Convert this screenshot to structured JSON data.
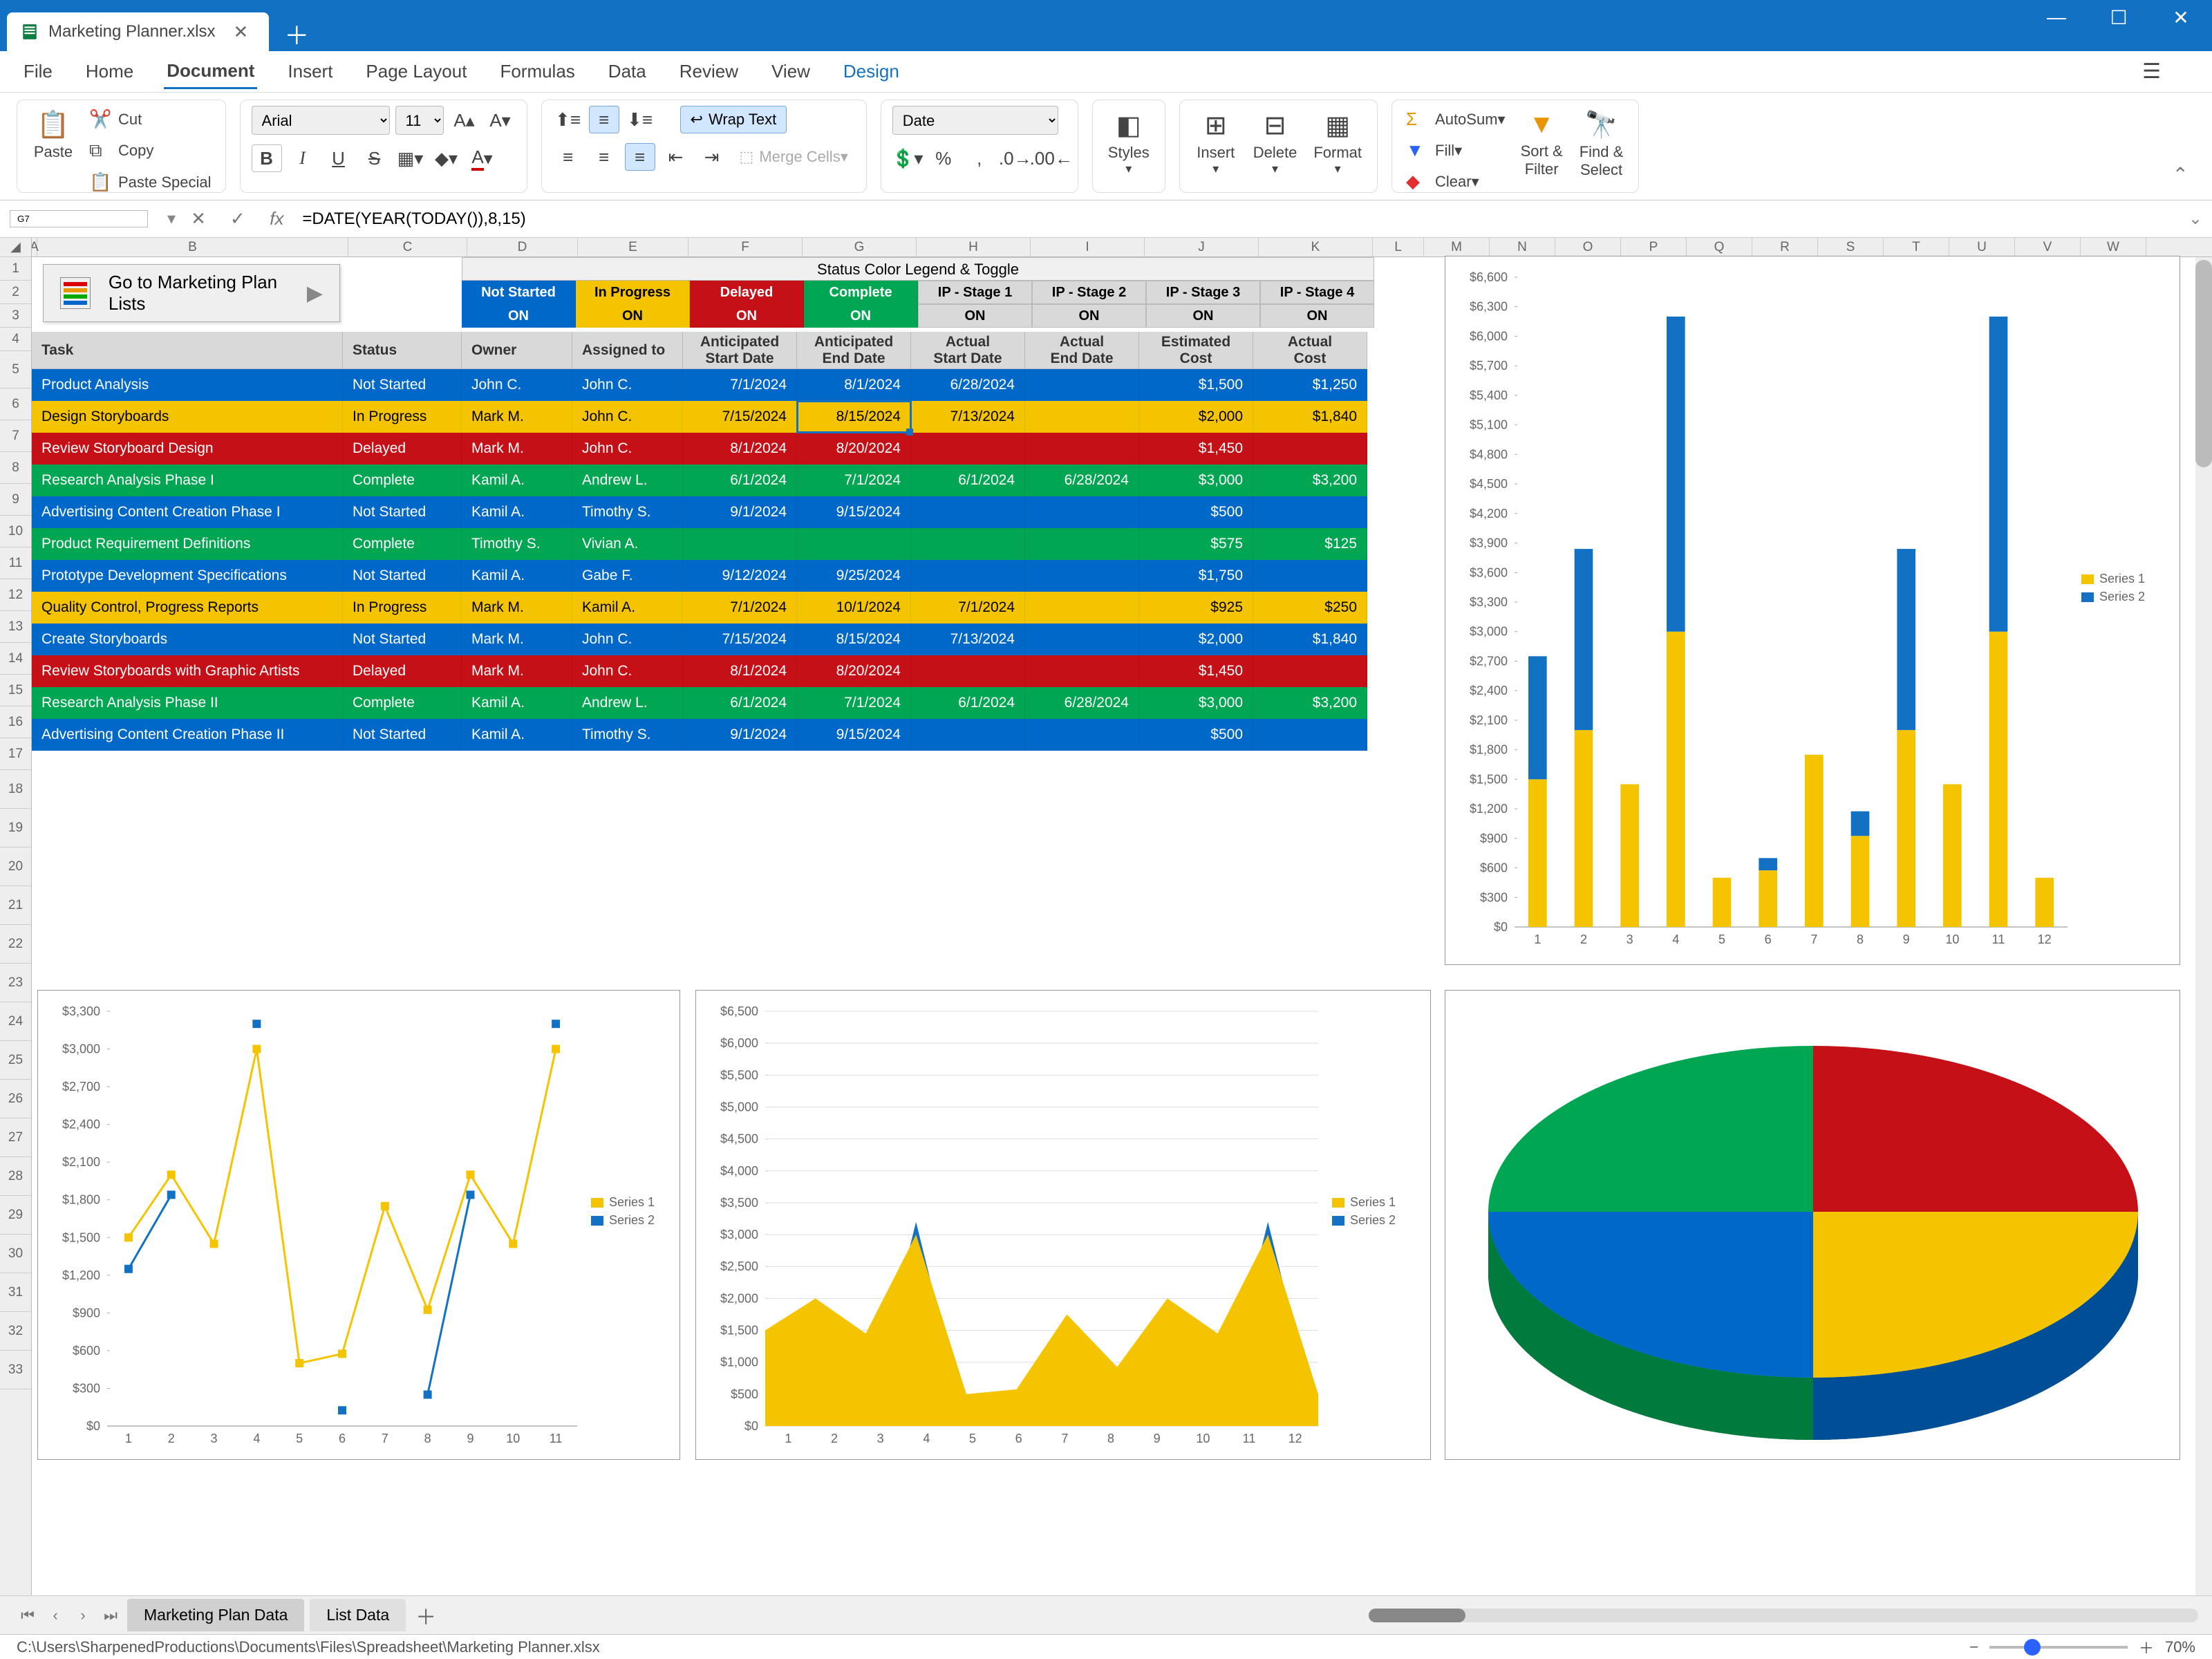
{
  "title": "Marketing Planner.xlsx",
  "menus": [
    "File",
    "Home",
    "Document",
    "Insert",
    "Page Layout",
    "Formulas",
    "Data",
    "Review",
    "View",
    "Design"
  ],
  "active_menu": "Document",
  "clipboard": {
    "paste": "Paste",
    "cut": "Cut",
    "copy": "Copy",
    "paste_special": "Paste Special"
  },
  "font": {
    "name": "Arial",
    "size": "11"
  },
  "wrap_text": "Wrap Text",
  "merge": "Merge Cells",
  "number_format": "Date",
  "groups": {
    "styles": "Styles",
    "insert": "Insert",
    "delete": "Delete",
    "format": "Format",
    "autosum": "AutoSum",
    "fill": "Fill",
    "clear": "Clear",
    "sort": "Sort &\nFilter",
    "find": "Find &\nSelect"
  },
  "cell_ref": "G7",
  "formula": "=DATE(YEAR(TODAY()),8,15)",
  "cols": [
    "A",
    "B",
    "C",
    "D",
    "E",
    "F",
    "G",
    "H",
    "I",
    "J",
    "K",
    "L",
    "M",
    "N",
    "O",
    "P",
    "Q",
    "R",
    "S",
    "T",
    "U",
    "V",
    "W"
  ],
  "goto": "Go to Marketing Plan Lists",
  "legend_title": "Status Color Legend & Toggle",
  "legend_top": [
    "Not Started",
    "In Progress",
    "Delayed",
    "Complete",
    "IP - Stage 1",
    "IP - Stage 2",
    "IP - Stage 3",
    "IP - Stage 4"
  ],
  "legend_on": "ON",
  "headers": [
    "Task",
    "Status",
    "Owner",
    "Assigned to",
    "Anticipated\nStart Date",
    "Anticipated\nEnd Date",
    "Actual\nStart Date",
    "Actual\nEnd Date",
    "Estimated\nCost",
    "Actual\nCost"
  ],
  "rows": [
    {
      "c": "blue",
      "task": "Product Analysis",
      "status": "Not Started",
      "owner": "John C.",
      "assigned": "John C.",
      "asd": "7/1/2024",
      "aed": "8/1/2024",
      "acsd": "6/28/2024",
      "aced": "",
      "est": "$1,500",
      "act": "$1,250"
    },
    {
      "c": "yellow",
      "task": "Design Storyboards",
      "status": "In Progress",
      "owner": "Mark M.",
      "assigned": "John C.",
      "asd": "7/15/2024",
      "aed": "8/15/2024",
      "acsd": "7/13/2024",
      "aced": "",
      "est": "$2,000",
      "act": "$1,840"
    },
    {
      "c": "red",
      "task": "Review Storyboard Design",
      "status": "Delayed",
      "owner": "Mark M.",
      "assigned": "John C.",
      "asd": "8/1/2024",
      "aed": "8/20/2024",
      "acsd": "",
      "aced": "",
      "est": "$1,450",
      "act": ""
    },
    {
      "c": "green",
      "task": "Research Analysis Phase I",
      "status": "Complete",
      "owner": "Kamil A.",
      "assigned": "Andrew L.",
      "asd": "6/1/2024",
      "aed": "7/1/2024",
      "acsd": "6/1/2024",
      "aced": "6/28/2024",
      "est": "$3,000",
      "act": "$3,200"
    },
    {
      "c": "blue",
      "task": "Advertising Content Creation Phase I",
      "status": "Not Started",
      "owner": "Kamil A.",
      "assigned": "Timothy S.",
      "asd": "9/1/2024",
      "aed": "9/15/2024",
      "acsd": "",
      "aced": "",
      "est": "$500",
      "act": ""
    },
    {
      "c": "green",
      "task": "Product Requirement Definitions",
      "status": "Complete",
      "owner": "Timothy S.",
      "assigned": "Vivian A.",
      "asd": "",
      "aed": "",
      "acsd": "",
      "aced": "",
      "est": "$575",
      "act": "$125"
    },
    {
      "c": "blue",
      "task": "Prototype Development Specifications",
      "status": "Not Started",
      "owner": "Kamil A.",
      "assigned": "Gabe F.",
      "asd": "9/12/2024",
      "aed": "9/25/2024",
      "acsd": "",
      "aced": "",
      "est": "$1,750",
      "act": ""
    },
    {
      "c": "yellow",
      "task": "Quality Control, Progress Reports",
      "status": "In Progress",
      "owner": "Mark M.",
      "assigned": "Kamil A.",
      "asd": "7/1/2024",
      "aed": "10/1/2024",
      "acsd": "7/1/2024",
      "aced": "",
      "est": "$925",
      "act": "$250"
    },
    {
      "c": "blue",
      "task": "Create Storyboards",
      "status": "Not Started",
      "owner": "Mark M.",
      "assigned": "John C.",
      "asd": "7/15/2024",
      "aed": "8/15/2024",
      "acsd": "7/13/2024",
      "aced": "",
      "est": "$2,000",
      "act": "$1,840"
    },
    {
      "c": "red",
      "task": "Review Storyboards with Graphic Artists",
      "status": "Delayed",
      "owner": "Mark M.",
      "assigned": "John C.",
      "asd": "8/1/2024",
      "aed": "8/20/2024",
      "acsd": "",
      "aced": "",
      "est": "$1,450",
      "act": ""
    },
    {
      "c": "green",
      "task": "Research Analysis Phase II",
      "status": "Complete",
      "owner": "Kamil A.",
      "assigned": "Andrew L.",
      "asd": "6/1/2024",
      "aed": "7/1/2024",
      "acsd": "6/1/2024",
      "aced": "6/28/2024",
      "est": "$3,000",
      "act": "$3,200"
    },
    {
      "c": "blue",
      "task": "Advertising Content Creation Phase II",
      "status": "Not Started",
      "owner": "Kamil A.",
      "assigned": "Timothy S.",
      "asd": "9/1/2024",
      "aed": "9/15/2024",
      "acsd": "",
      "aced": "",
      "est": "$500",
      "act": ""
    }
  ],
  "sheet_tabs": [
    "Marketing Plan Data",
    "List Data"
  ],
  "status_path": "C:\\Users\\SharpenedProductions\\Documents\\Files\\Spreadsheet\\Marketing Planner.xlsx",
  "zoom": "70%",
  "chart_data": [
    {
      "type": "bar",
      "title": "",
      "categories": [
        1,
        2,
        3,
        4,
        5,
        6,
        7,
        8,
        9,
        10,
        11,
        12
      ],
      "series": [
        {
          "name": "Series 1",
          "color": "#f5c400",
          "values": [
            1500,
            2000,
            1450,
            3000,
            500,
            575,
            1750,
            925,
            2000,
            1450,
            3000,
            500
          ]
        },
        {
          "name": "Series 2",
          "color": "#1371c3",
          "values": [
            1250,
            1840,
            0,
            3200,
            0,
            125,
            0,
            250,
            1840,
            0,
            3200,
            0
          ]
        }
      ],
      "ylim": [
        0,
        6600
      ],
      "ystep": 300,
      "stacked": true
    },
    {
      "type": "line",
      "categories": [
        1,
        2,
        3,
        4,
        5,
        6,
        7,
        8,
        9,
        10,
        11
      ],
      "series": [
        {
          "name": "Series 1",
          "color": "#f5c400",
          "values": [
            1500,
            2000,
            1450,
            3000,
            500,
            575,
            1750,
            925,
            2000,
            1450,
            3000
          ]
        },
        {
          "name": "Series 2",
          "color": "#1371c3",
          "values": [
            1250,
            1840,
            null,
            3200,
            null,
            125,
            null,
            250,
            1840,
            null,
            3200
          ]
        }
      ],
      "ylim": [
        0,
        3300
      ],
      "ystep": 300
    },
    {
      "type": "area",
      "categories": [
        1,
        2,
        3,
        4,
        5,
        6,
        7,
        8,
        9,
        10,
        11,
        12
      ],
      "series": [
        {
          "name": "Series 1",
          "color": "#f5c400",
          "values": [
            1500,
            2000,
            1450,
            3000,
            500,
            575,
            1750,
            925,
            2000,
            1450,
            3000,
            500
          ]
        },
        {
          "name": "Series 2",
          "color": "#1371c3",
          "values": [
            1250,
            1840,
            0,
            3200,
            0,
            125,
            0,
            250,
            1840,
            0,
            3200,
            0
          ]
        }
      ],
      "ylim": [
        0,
        6500
      ],
      "ystep": 500
    },
    {
      "type": "pie",
      "slices": [
        {
          "label": "red",
          "value": 25,
          "color": "#c61017"
        },
        {
          "label": "yellow",
          "value": 25,
          "color": "#f5c400"
        },
        {
          "label": "blue",
          "value": 25,
          "color": "#0068c9"
        },
        {
          "label": "green",
          "value": 25,
          "color": "#00a651"
        }
      ]
    }
  ],
  "legend_s1": "Series 1",
  "legend_s2": "Series 2"
}
